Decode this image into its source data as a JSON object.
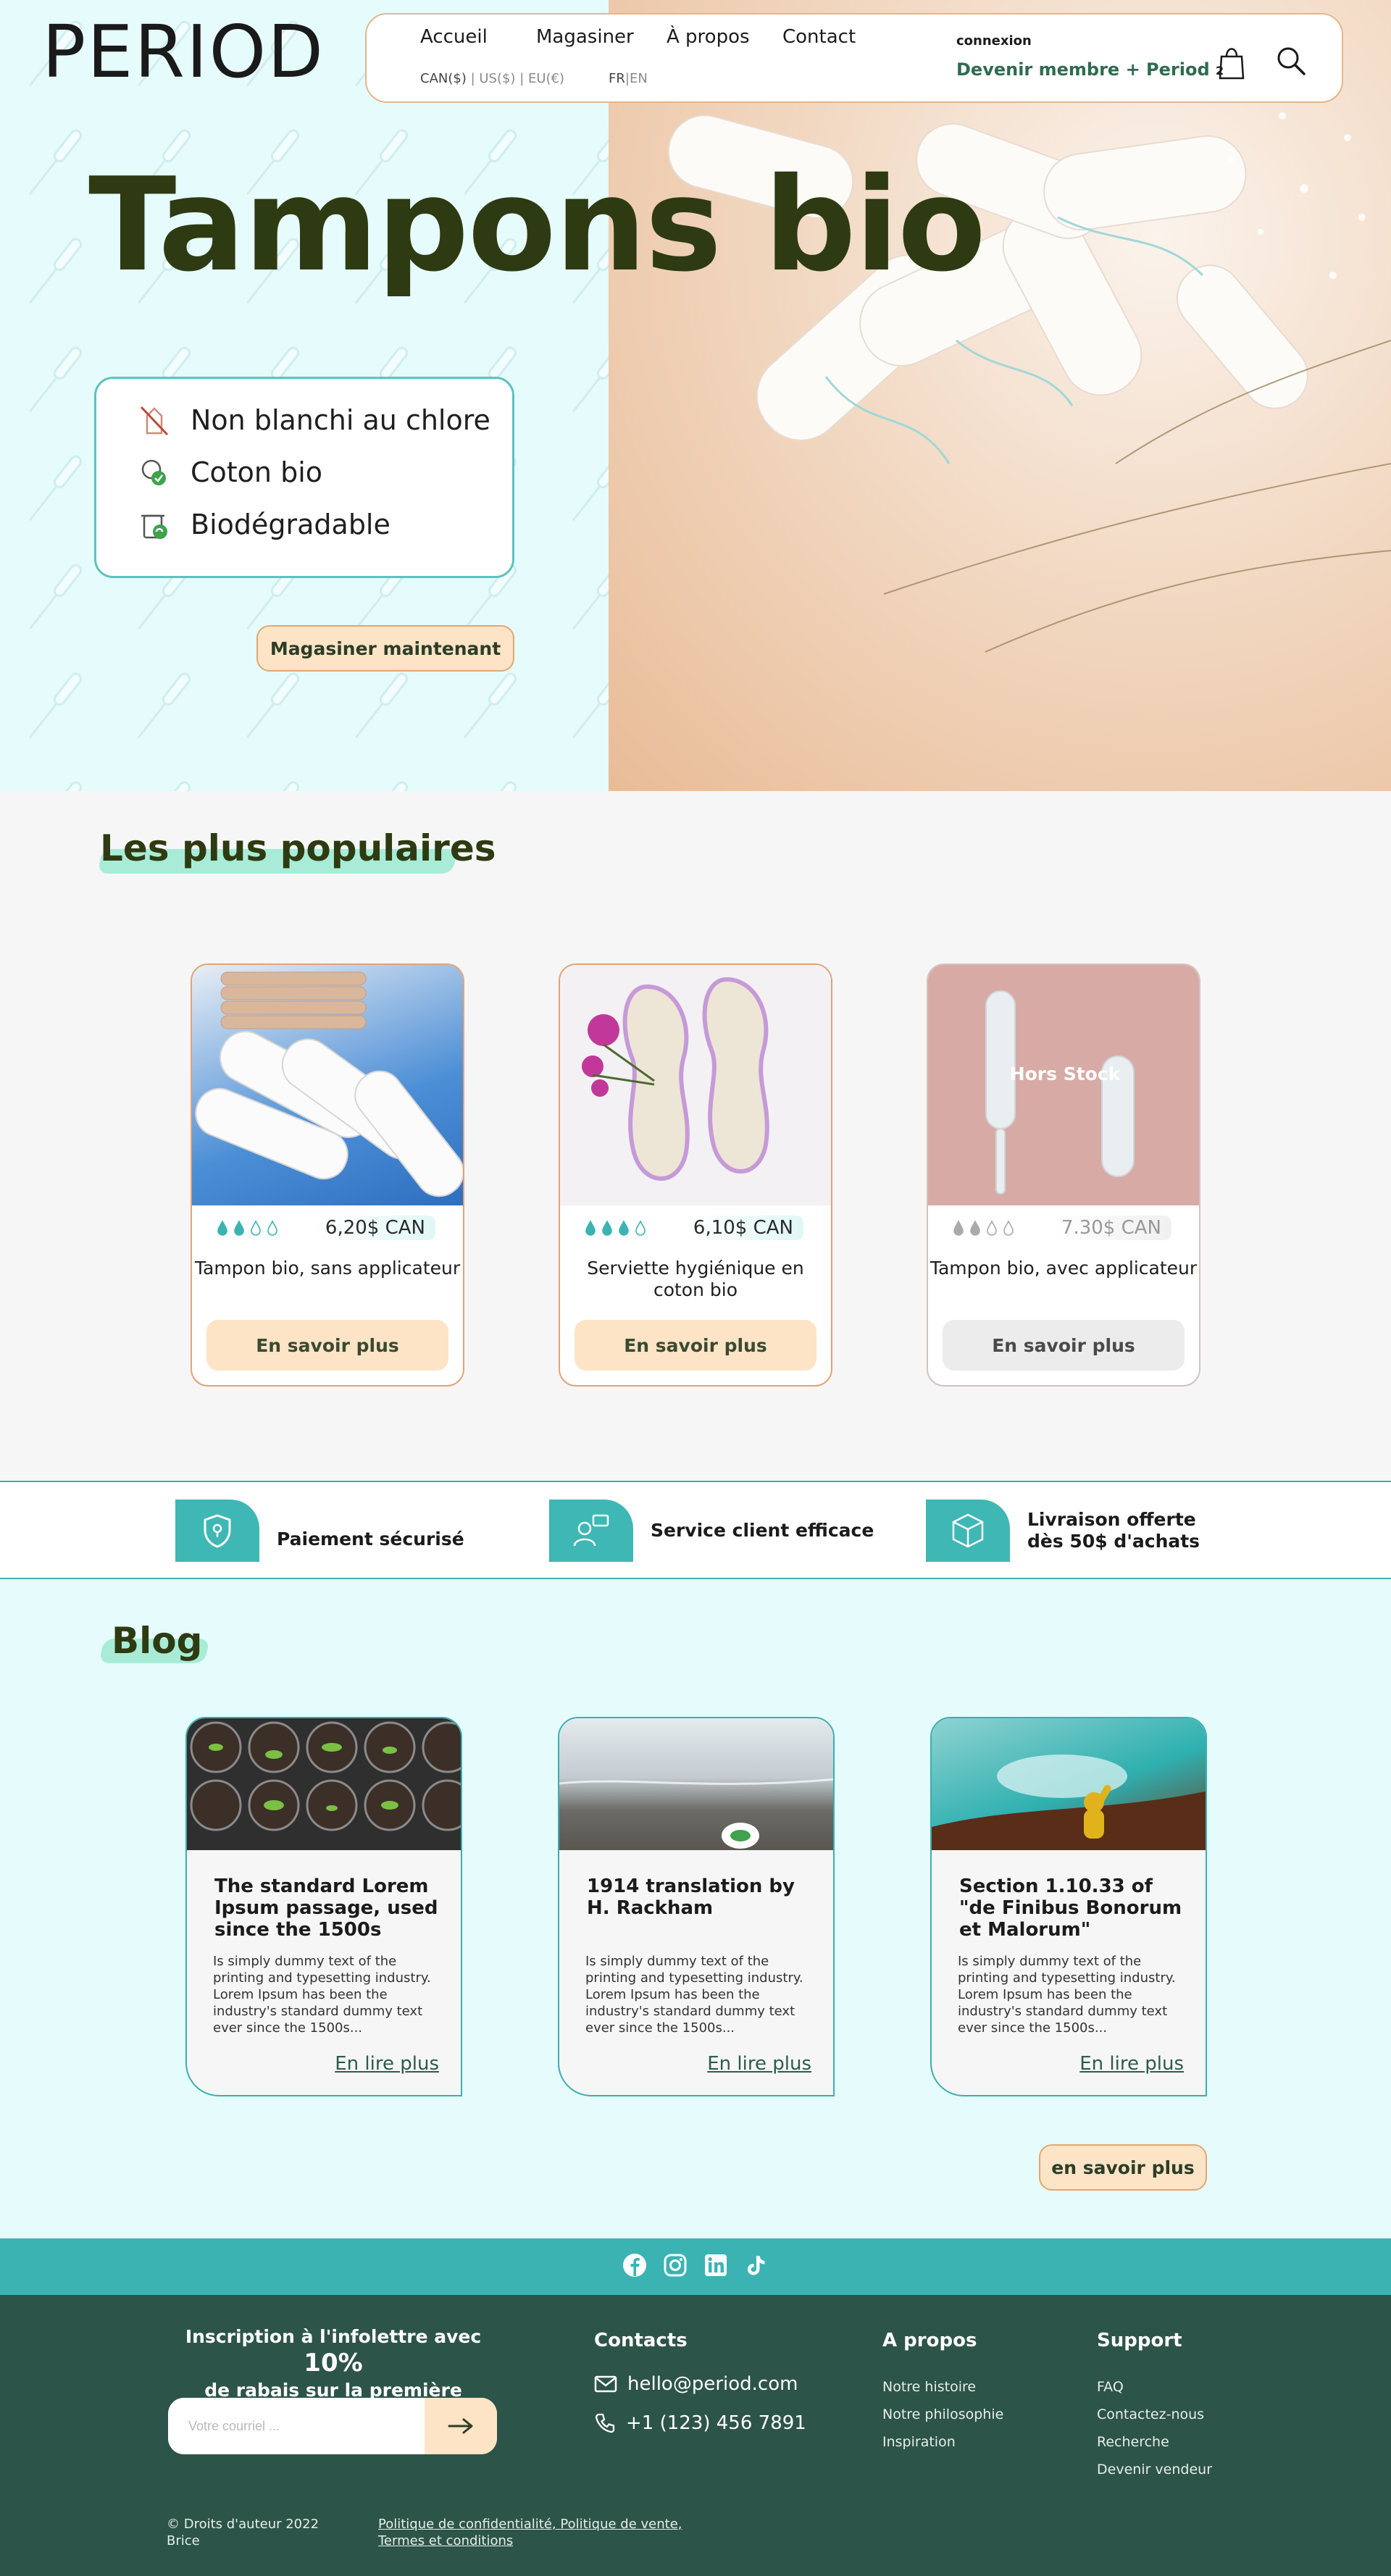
{
  "brand": {
    "logo": "PERIOD"
  },
  "nav": {
    "items": [
      "Accueil",
      "Magasiner",
      "À propos",
      "Contact"
    ],
    "currency": {
      "active": "CAN($)",
      "sep1": " | ",
      "opt2": "US($)",
      "sep2": " | ",
      "opt3": "EU(€)"
    },
    "lang": {
      "active": "FR",
      "sep": "|",
      "other": "EN"
    },
    "login": "connexion",
    "member": "Devenir membre + Period",
    "cart_count": "2"
  },
  "hero": {
    "title": "Tampons bio",
    "features": [
      "Non blanchi au chlore",
      "Coton bio",
      "Biodégradable"
    ],
    "cta": "Magasiner maintenant"
  },
  "popular": {
    "title": "Les plus populaires",
    "products": [
      {
        "price": "6,20$ CAN",
        "name": "Tampon bio, sans applicateur",
        "cta": "En savoir plus",
        "drops": 2,
        "in_stock": true
      },
      {
        "price": "6,10$ CAN",
        "name": "Serviette hygiénique en coton bio",
        "cta": "En savoir plus",
        "drops": 3,
        "in_stock": true
      },
      {
        "price": "7.30$ CAN",
        "name": "Tampon bio, avec applicateur",
        "cta": "En savoir plus",
        "drops": 2,
        "in_stock": false,
        "badge": "Hors Stock"
      }
    ]
  },
  "features": [
    "Paiement sécurisé",
    "Service client efficace",
    "Livraison offerte dès 50$ d'achats"
  ],
  "blog": {
    "title": "Blog",
    "posts": [
      {
        "title": "The standard Lorem Ipsum passage, used since the 1500s",
        "text": "Is simply dummy text of the printing and typesetting industry. Lorem Ipsum has been the industry's standard dummy text ever since the 1500s...",
        "link": "En lire plus"
      },
      {
        "title": "1914 translation by H. Rackham",
        "text": "Is simply dummy text of the printing and typesetting industry. Lorem Ipsum has been the industry's standard dummy text ever since the 1500s...",
        "link": "En lire plus"
      },
      {
        "title": "Section 1.10.33 of \"de Finibus Bonorum et Malorum\"",
        "text": "Is simply dummy text of the printing and typesetting industry. Lorem Ipsum has been the industry's standard dummy text ever since the 1500s...",
        "link": "En lire plus"
      }
    ],
    "more": "en savoir plus"
  },
  "social": [
    "facebook-icon",
    "instagram-icon",
    "linkedin-icon",
    "tiktok-icon"
  ],
  "footer": {
    "newsletter": {
      "line1a": "Inscription à l'infolettre avec ",
      "line1b": "10%",
      "line2": "de rabais sur la première commande",
      "placeholder": "Votre courriel ..."
    },
    "contacts": {
      "title": "Contacts",
      "email": "hello@period.com",
      "phone": "+1 (123) 456 7891"
    },
    "about": {
      "title": "A propos",
      "links": [
        "Notre histoire",
        "Notre philosophie",
        "Inspiration"
      ]
    },
    "support": {
      "title": "Support",
      "links": [
        "FAQ",
        "Contactez-nous",
        "Recherche",
        "Devenir vendeur"
      ]
    },
    "copyright": [
      "© Droits d'auteur 2022",
      "Brice"
    ],
    "legal": [
      "Politique de confidentialité, Politique de vente,",
      "Termes et conditions"
    ]
  },
  "colors": {
    "accent": "#3bb3b3",
    "title": "#2e3b12",
    "peach": "#fde4c6",
    "footer": "#2d5448",
    "mint": "#a8ecd8"
  }
}
